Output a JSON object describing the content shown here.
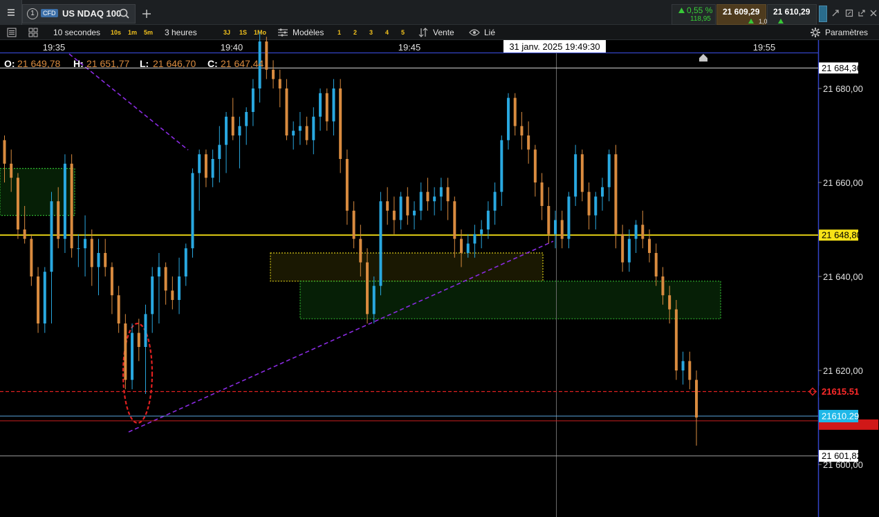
{
  "header": {
    "menu_icon": "hamburger-menu-icon",
    "panel_number": "1",
    "instrument_type": "CFD",
    "instrument_name": "US NDAQ 100",
    "change_percent": "0,55 %",
    "change_points": "118,95",
    "bid": "21 609,29",
    "ask": "21 610,29",
    "spread": "1,00",
    "window_icons": [
      "detach-icon",
      "expand-icon",
      "popout-icon",
      "close-icon"
    ]
  },
  "toolbar": {
    "interval_label": "10 secondes",
    "quick_intervals": [
      "10s",
      "1m",
      "5m"
    ],
    "period_label": "3 heures",
    "quick_periods": [
      "3J",
      "1S",
      "1Mo"
    ],
    "models_label": "Modèles",
    "model_slots": [
      "1",
      "2",
      "3",
      "4",
      "5"
    ],
    "side_label": "Vente",
    "linked_label": "Lié",
    "settings_label": "Paramètres"
  },
  "ohlc": {
    "o_label": "O:",
    "o": "21 649,78",
    "h_label": "H:",
    "h": "21 651,77",
    "l_label": "L:",
    "l": "21 646,70",
    "c_label": "C:",
    "c": "21 647,44"
  },
  "chart_data": {
    "type": "candlestick",
    "x_axis": {
      "ticks": [
        "19:35",
        "19:40",
        "19:45",
        "19:55"
      ],
      "crosshair_label": "31 janv. 2025 19:49:30"
    },
    "y_axis": {
      "range": [
        21595,
        21692
      ],
      "ticks": [
        "21 680,00",
        "21 660,00",
        "21 640,00",
        "21 620,00",
        "21 600,00"
      ]
    },
    "price_labels": [
      {
        "text": "21 684,36",
        "value": 21684.36
      },
      {
        "text": "21 648,80",
        "value": 21648.8
      },
      {
        "text": "21615.51",
        "value": 21615.51
      },
      {
        "text": "21610.29",
        "value": 21610.29
      },
      {
        "text": "21 601,82",
        "value": 21601.82
      }
    ],
    "colors": {
      "up": "#29a8e0",
      "down": "#d98b3f",
      "horizontal_line": "#f7e217",
      "stop_line": "#e02020",
      "trend_line": "#8a2be2"
    },
    "candles": [
      [
        21669,
        21670,
        21660,
        21664
      ],
      [
        21664,
        21667,
        21658,
        21661
      ],
      [
        21661,
        21662,
        21648,
        21650
      ],
      [
        21650,
        21655,
        21647,
        21648
      ],
      [
        21648,
        21649,
        21638,
        21640
      ],
      [
        21640,
        21642,
        21628,
        21630
      ],
      [
        21630,
        21642,
        21628,
        21641
      ],
      [
        21641,
        21658,
        21630,
        21656
      ],
      [
        21656,
        21659,
        21646,
        21648
      ],
      [
        21648,
        21666,
        21645,
        21664
      ],
      [
        21664,
        21666,
        21644,
        21646
      ],
      [
        21646,
        21649,
        21642,
        21646
      ],
      [
        21646,
        21653,
        21640,
        21648
      ],
      [
        21648,
        21650,
        21638,
        21642
      ],
      [
        21642,
        21648,
        21636,
        21645
      ],
      [
        21645,
        21648,
        21640,
        21642
      ],
      [
        21642,
        21643,
        21632,
        21636
      ],
      [
        21636,
        21638,
        21628,
        21630
      ],
      [
        21630,
        21632,
        21616,
        21618
      ],
      [
        21618,
        21630,
        21616,
        21628
      ],
      [
        21628,
        21631,
        21622,
        21625
      ],
      [
        21625,
        21634,
        21615,
        21632
      ],
      [
        21632,
        21642,
        21628,
        21640
      ],
      [
        21640,
        21645,
        21630,
        21642
      ],
      [
        21642,
        21643,
        21634,
        21637
      ],
      [
        21637,
        21640,
        21633,
        21635
      ],
      [
        21635,
        21644,
        21632,
        21640
      ],
      [
        21640,
        21647,
        21638,
        21646
      ],
      [
        21646,
        21663,
        21644,
        21662
      ],
      [
        21662,
        21667,
        21654,
        21666
      ],
      [
        21666,
        21667,
        21659,
        21661
      ],
      [
        21661,
        21667,
        21659,
        21665
      ],
      [
        21665,
        21672,
        21660,
        21668
      ],
      [
        21668,
        21675,
        21662,
        21674
      ],
      [
        21674,
        21678,
        21669,
        21670
      ],
      [
        21670,
        21674,
        21663,
        21672
      ],
      [
        21672,
        21676,
        21668,
        21675
      ],
      [
        21675,
        21682,
        21672,
        21680
      ],
      [
        21680,
        21692,
        21677,
        21690
      ],
      [
        21690,
        21691,
        21682,
        21684
      ],
      [
        21684,
        21686,
        21680,
        21682
      ],
      [
        21682,
        21684,
        21676,
        21680
      ],
      [
        21680,
        21682,
        21669,
        21670
      ],
      [
        21670,
        21673,
        21667,
        21671
      ],
      [
        21671,
        21675,
        21668,
        21672
      ],
      [
        21672,
        21674,
        21668,
        21669
      ],
      [
        21669,
        21676,
        21666,
        21674
      ],
      [
        21674,
        21680,
        21671,
        21679
      ],
      [
        21679,
        21680,
        21671,
        21673
      ],
      [
        21673,
        21682,
        21670,
        21680
      ],
      [
        21680,
        21682,
        21662,
        21665
      ],
      [
        21665,
        21667,
        21651,
        21654
      ],
      [
        21654,
        21656,
        21646,
        21648
      ],
      [
        21648,
        21651,
        21640,
        21643
      ],
      [
        21643,
        21646,
        21630,
        21632
      ],
      [
        21632,
        21640,
        21630,
        21638
      ],
      [
        21638,
        21658,
        21636,
        21656
      ],
      [
        21656,
        21659,
        21651,
        21654
      ],
      [
        21654,
        21657,
        21649,
        21652
      ],
      [
        21652,
        21658,
        21650,
        21657
      ],
      [
        21657,
        21659,
        21651,
        21653
      ],
      [
        21653,
        21656,
        21650,
        21654
      ],
      [
        21654,
        21660,
        21652,
        21658
      ],
      [
        21658,
        21661,
        21654,
        21656
      ],
      [
        21656,
        21659,
        21653,
        21657
      ],
      [
        21657,
        21661,
        21654,
        21659
      ],
      [
        21659,
        21661,
        21652,
        21656
      ],
      [
        21656,
        21657,
        21644,
        21648
      ],
      [
        21648,
        21650,
        21642,
        21645
      ],
      [
        21645,
        21649,
        21644,
        21647
      ],
      [
        21647,
        21651,
        21644,
        21649
      ],
      [
        21649,
        21652,
        21646,
        21650
      ],
      [
        21650,
        21656,
        21648,
        21654
      ],
      [
        21654,
        21660,
        21651,
        21658
      ],
      [
        21658,
        21670,
        21655,
        21669
      ],
      [
        21669,
        21679,
        21667,
        21678
      ],
      [
        21678,
        21679,
        21670,
        21672
      ],
      [
        21672,
        21675,
        21667,
        21670
      ],
      [
        21670,
        21673,
        21664,
        21667
      ],
      [
        21667,
        21668,
        21657,
        21660
      ],
      [
        21660,
        21662,
        21652,
        21655
      ],
      [
        21655,
        21659,
        21647,
        21649
      ],
      [
        21649,
        21654,
        21646,
        21652
      ],
      [
        21652,
        21654,
        21646,
        21648
      ],
      [
        21648,
        21658,
        21646,
        21657
      ],
      [
        21657,
        21668,
        21655,
        21666
      ],
      [
        21666,
        21667,
        21656,
        21658
      ],
      [
        21658,
        21660,
        21650,
        21653
      ],
      [
        21653,
        21658,
        21650,
        21657
      ],
      [
        21657,
        21661,
        21654,
        21659
      ],
      [
        21659,
        21667,
        21656,
        21666
      ],
      [
        21666,
        21668,
        21646,
        21649
      ],
      [
        21649,
        21651,
        21641,
        21643
      ],
      [
        21643,
        21650,
        21641,
        21648
      ],
      [
        21648,
        21652,
        21645,
        21651
      ],
      [
        21651,
        21654,
        21646,
        21648
      ],
      [
        21648,
        21650,
        21643,
        21645
      ],
      [
        21645,
        21647,
        21638,
        21640
      ],
      [
        21640,
        21642,
        21634,
        21636
      ],
      [
        21636,
        21638,
        21630,
        21633
      ],
      [
        21633,
        21635,
        21618,
        21620
      ],
      [
        21620,
        21624,
        21617,
        21622
      ],
      [
        21622,
        21624,
        21616,
        21618
      ],
      [
        21618,
        21620,
        21604,
        21610
      ]
    ],
    "zones": [
      {
        "color": "green",
        "price_range": [
          21653,
          21663
        ]
      },
      {
        "color": "yellow",
        "price_range": [
          21639,
          21645
        ]
      },
      {
        "color": "green",
        "price_range": [
          21631,
          21639
        ]
      }
    ]
  }
}
